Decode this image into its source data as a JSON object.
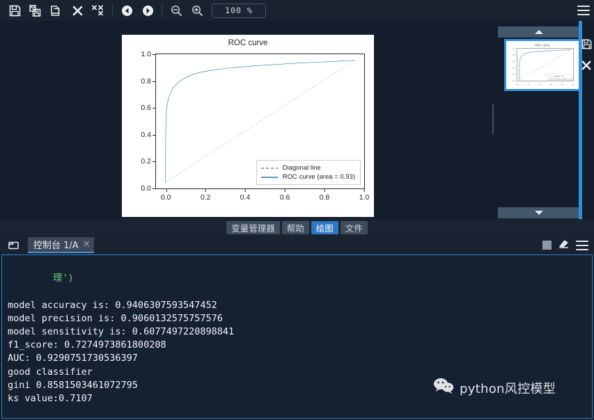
{
  "theme": {
    "bg": "#131d2b",
    "panel_bg": "#19222f",
    "accent_blue": "#2f8fdd",
    "tab_active_bg": "#2f77c4",
    "console_border": "#2f7fc4",
    "curve_blue": "#1f77b4",
    "diagonal_gray": "#808080",
    "console_text": "#f2f5f8",
    "console_first_line": "#6fce6f"
  },
  "toolbar": {
    "buttons": [
      {
        "name": "save-icon",
        "label": "Save"
      },
      {
        "name": "save-all-icon",
        "label": "Save all"
      },
      {
        "name": "copy-icon",
        "label": "Copy"
      },
      {
        "name": "close-icon",
        "label": "Close"
      },
      {
        "name": "close-all-icon",
        "label": "Close all"
      },
      {
        "name": "previous-icon",
        "label": "Previous"
      },
      {
        "name": "next-icon",
        "label": "Next"
      },
      {
        "name": "zoom-out-icon",
        "label": "Zoom out"
      },
      {
        "name": "zoom-in-icon",
        "label": "Zoom in"
      }
    ],
    "zoom_value": "100 %",
    "menu_label": "Options"
  },
  "chart_data": {
    "type": "line",
    "title": "ROC curve",
    "xlabel": "",
    "ylabel": "",
    "xlim": [
      -0.05,
      1.05
    ],
    "ylim": [
      -0.05,
      1.05
    ],
    "xticks": [
      "0.0",
      "0.2",
      "0.4",
      "0.6",
      "0.8",
      "1.0"
    ],
    "yticks": [
      "0.0",
      "0.2",
      "0.4",
      "0.6",
      "0.8",
      "1.0"
    ],
    "grid": false,
    "legend_position": "lower right",
    "series": [
      {
        "name": "Diagonal line",
        "style": "dashed",
        "color": "#808080",
        "x": [
          0.0,
          1.0
        ],
        "y": [
          0.0,
          1.0
        ]
      },
      {
        "name": "ROC curve (area = 0.93)",
        "style": "solid",
        "color": "#1f77b4",
        "x": [
          0.0,
          0.001,
          0.002,
          0.004,
          0.006,
          0.01,
          0.015,
          0.022,
          0.03,
          0.04,
          0.055,
          0.07,
          0.09,
          0.115,
          0.145,
          0.18,
          0.22,
          0.27,
          0.33,
          0.4,
          0.47,
          0.54,
          0.62,
          0.7,
          0.78,
          0.86,
          0.93,
          0.97,
          1.0
        ],
        "y": [
          0.0,
          0.3,
          0.45,
          0.545,
          0.6,
          0.645,
          0.68,
          0.715,
          0.745,
          0.772,
          0.8,
          0.822,
          0.845,
          0.865,
          0.885,
          0.9,
          0.912,
          0.925,
          0.936,
          0.945,
          0.954,
          0.962,
          0.97,
          0.977,
          0.983,
          0.989,
          0.995,
          0.998,
          1.0
        ]
      }
    ]
  },
  "thumbnails": {
    "scroll_up_label": "Scroll up",
    "scroll_down_label": "Scroll down",
    "items": [
      {
        "name": "plot-thumbnail-roc",
        "title": "ROC curve",
        "selected": true
      }
    ],
    "side_buttons": [
      {
        "name": "save-plot-icon",
        "label": "Save plot"
      },
      {
        "name": "close-plot-icon",
        "label": "Close plot"
      }
    ]
  },
  "plot_tabs": [
    {
      "label": "变量管理器",
      "active": false,
      "name": "tab-variable-explorer"
    },
    {
      "label": "帮助",
      "active": false,
      "name": "tab-help"
    },
    {
      "label": "绘图",
      "active": true,
      "name": "tab-plots"
    },
    {
      "label": "文件",
      "active": false,
      "name": "tab-files"
    }
  ],
  "console": {
    "tab_label": "控制台 1/A",
    "tab_close": "✕",
    "browse_icon_label": "Browse tabs",
    "stop_label": "Stop",
    "clear_label": "Clear console",
    "menu_label": "Options",
    "lines": [
      "理')",
      "model accuracy is: 0.9406307593547452",
      "model precision is: 0.9060132575757576",
      "model sensitivity is: 0.6077497220898841",
      "f1_score: 0.7274973861800208",
      "AUC: 0.9290751730536397",
      "good classifier",
      "gini 0.8581503461072795",
      "ks value:0.7107"
    ]
  },
  "watermark": {
    "text": "python风控模型",
    "icon": "wechat-icon"
  }
}
